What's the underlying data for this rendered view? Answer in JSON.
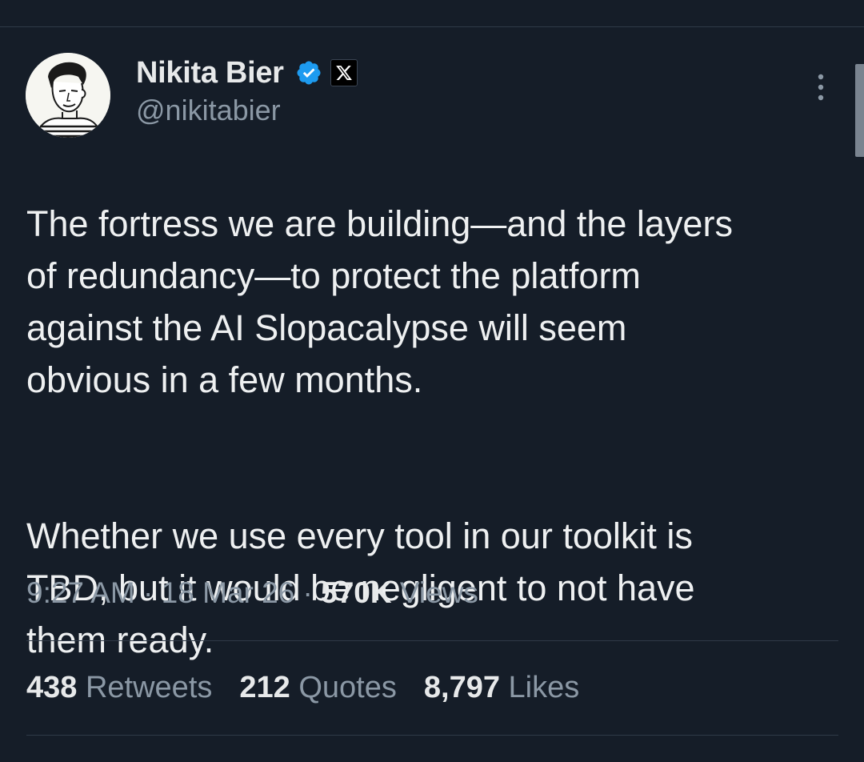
{
  "author": {
    "display_name": "Nikita Bier",
    "handle": "@nikitabier",
    "verified": true,
    "affiliation_badge": "x-logo-icon"
  },
  "tweet": {
    "paragraphs": [
      "The fortress we are building—and the layers\nof redundancy—to protect the platform\nagainst the AI Slopacalypse will seem\nobvious in a few months.",
      "Whether we use every tool in our toolkit is\nTBD, but it would be negligent to not have\nthem ready."
    ]
  },
  "meta": {
    "time": "9:27 AM",
    "sep1": " · ",
    "date": "18 Mar 26",
    "sep2": " · ",
    "views_count": "570K",
    "views_label": " Views"
  },
  "stats": [
    {
      "count": "438",
      "label": "Retweets"
    },
    {
      "count": "212",
      "label": "Quotes"
    },
    {
      "count": "8,797",
      "label": "Likes"
    }
  ],
  "colors": {
    "background": "#151d28",
    "text_primary": "#e7e9ea",
    "text_secondary": "#8b98a5",
    "verified_blue": "#1d9bf0",
    "divider": "#2f3a47"
  }
}
